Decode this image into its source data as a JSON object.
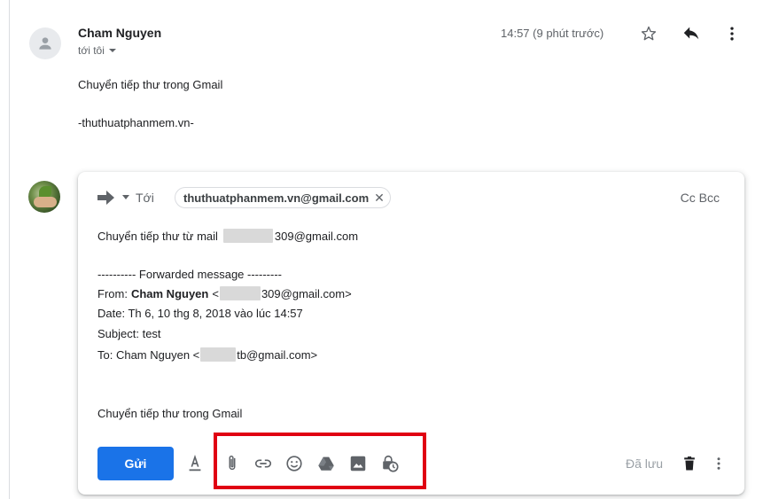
{
  "message": {
    "sender_name": "Cham Nguyen",
    "recipient_label": "tới tôi",
    "time": "14:57 (9 phút trước)",
    "body_line1": "Chuyển tiếp thư trong Gmail",
    "body_line2": "-thuthuatphanmem.vn-"
  },
  "compose": {
    "to_label": "Tới",
    "recipient_chip": "thuthuatphanmem.vn@gmail.com",
    "cc_bcc": "Cc Bcc",
    "line1_prefix": "Chuyển tiếp thư từ mail",
    "line1_suffix": "309@gmail.com",
    "fwd_header": "---------- Forwarded message ---------",
    "from_label": "From:",
    "from_name": "Cham Nguyen",
    "from_open": "<",
    "from_suffix": "309@gmail.com>",
    "date_line": "Date: Th 6, 10 thg 8, 2018 vào lúc 14:57",
    "subject_line": "Subject: test",
    "to_prefix": "To: Cham Nguyen <",
    "to_suffix": "tb@gmail.com>",
    "footer_line": "Chuyển tiếp thư trong Gmail"
  },
  "toolbar": {
    "send_label": "Gửi",
    "saved_label": "Đã lưu"
  },
  "icons": [
    "star-icon",
    "reply-icon",
    "more-vert-icon",
    "forward-icon",
    "format-text-icon",
    "attach-icon",
    "link-icon",
    "emoji-icon",
    "drive-icon",
    "photo-icon",
    "confidential-mode-icon",
    "trash-icon"
  ],
  "colors": {
    "send_button": "#1a73e8",
    "highlight_box": "#e00012"
  }
}
